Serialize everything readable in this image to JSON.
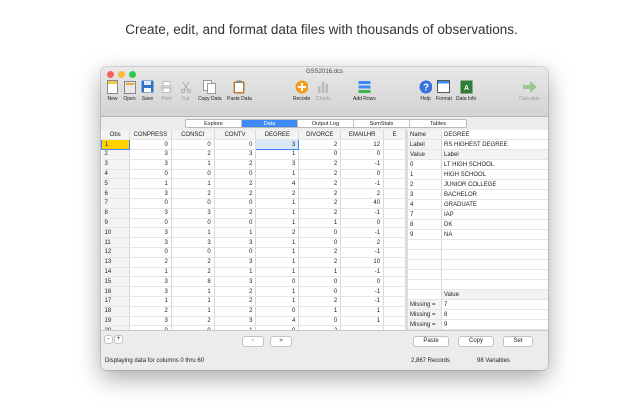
{
  "headline": "Create, edit, and format data files with thousands of observations.",
  "window": {
    "title": "GSS2016.dcs"
  },
  "toolbar": {
    "new": "New",
    "open": "Open",
    "save": "Save",
    "print": "Print",
    "cut": "Cut",
    "copy_data": "Copy Data",
    "paste_data": "Paste Data",
    "recode": "Recode",
    "charts": "Charts",
    "add_rows": "Add Rows",
    "help": "Help",
    "format": "Format",
    "data_info": "Data Info",
    "calculate": "Calculate"
  },
  "tabs": [
    "Explore",
    "Data",
    "Output Log",
    "SumStats",
    "Tables"
  ],
  "grid": {
    "columns": [
      "Obs",
      "CONPRESS",
      "CONSCI",
      "CONTV",
      "DEGREE",
      "DIVORCE",
      "EMAILHR",
      "E"
    ],
    "rows": [
      [
        "1",
        "0",
        "0",
        "0",
        "3",
        "2",
        "12",
        ""
      ],
      [
        "2",
        "3",
        "2",
        "3",
        "1",
        "0",
        "0",
        ""
      ],
      [
        "3",
        "3",
        "1",
        "2",
        "3",
        "2",
        "-1",
        ""
      ],
      [
        "4",
        "0",
        "0",
        "0",
        "1",
        "2",
        "0",
        ""
      ],
      [
        "5",
        "1",
        "1",
        "2",
        "4",
        "2",
        "-1",
        ""
      ],
      [
        "6",
        "3",
        "2",
        "2",
        "2",
        "2",
        "2",
        ""
      ],
      [
        "7",
        "0",
        "0",
        "0",
        "1",
        "2",
        "40",
        ""
      ],
      [
        "8",
        "3",
        "3",
        "2",
        "1",
        "2",
        "-1",
        ""
      ],
      [
        "9",
        "0",
        "0",
        "0",
        "1",
        "1",
        "0",
        ""
      ],
      [
        "10",
        "3",
        "1",
        "1",
        "2",
        "0",
        "-1",
        ""
      ],
      [
        "11",
        "3",
        "3",
        "3",
        "1",
        "0",
        "2",
        ""
      ],
      [
        "12",
        "0",
        "0",
        "0",
        "1",
        "2",
        "-1",
        ""
      ],
      [
        "13",
        "2",
        "2",
        "3",
        "1",
        "2",
        "10",
        ""
      ],
      [
        "14",
        "1",
        "2",
        "1",
        "1",
        "1",
        "-1",
        ""
      ],
      [
        "15",
        "3",
        "8",
        "3",
        "0",
        "0",
        "0",
        ""
      ],
      [
        "16",
        "3",
        "1",
        "2",
        "1",
        "0",
        "-1",
        ""
      ],
      [
        "17",
        "1",
        "1",
        "2",
        "1",
        "2",
        "-1",
        ""
      ],
      [
        "18",
        "2",
        "1",
        "2",
        "0",
        "1",
        "1",
        ""
      ],
      [
        "19",
        "3",
        "2",
        "3",
        "4",
        "0",
        "1",
        ""
      ],
      [
        "20",
        "0",
        "0",
        "1",
        "0",
        "2",
        "",
        ""
      ]
    ]
  },
  "variable": {
    "name_label": "Name",
    "name": "DEGREE",
    "label_label": "Label",
    "label": "RS HIGHEST DEGREE",
    "value_header": "Value",
    "label_header": "Label",
    "values": [
      [
        "0",
        "LT HIGH SCHOOL"
      ],
      [
        "1",
        "HIGH SCHOOL"
      ],
      [
        "2",
        "JUNIOR COLLEGE"
      ],
      [
        "3",
        "BACHELOR"
      ],
      [
        "4",
        "GRADUATE"
      ],
      [
        "7",
        "IAP"
      ],
      [
        "8",
        "DK"
      ],
      [
        "9",
        "NA"
      ]
    ],
    "missing_value_header": "Value",
    "missing": [
      [
        "Missing =",
        "7"
      ],
      [
        "Missing =",
        "8"
      ],
      [
        "Missing =",
        "9"
      ],
      [
        "Missing =",
        ""
      ]
    ]
  },
  "bottom": {
    "minus": "-",
    "plus": "+",
    "prev": "<",
    "next": ">",
    "paste": "Paste",
    "copy": "Copy",
    "set": "Set",
    "status": "Displaying data for columns 0 thru 60",
    "records": "2,867 Records",
    "variables": "98 Variables"
  }
}
